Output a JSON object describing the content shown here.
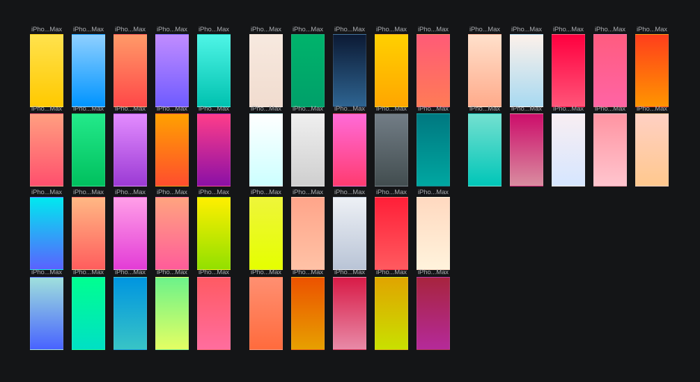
{
  "canvas": {
    "background": "#141517"
  },
  "frame_label": "iPho...Max",
  "groups": [
    {
      "rows": [
        [
          {
            "gradient": [
              "#ffe24d",
              "#ffc900"
            ]
          },
          {
            "gradient": [
              "#8fd0ff",
              "#0094ff"
            ]
          },
          {
            "gradient": [
              "#ff9a68",
              "#ff4848"
            ]
          },
          {
            "gradient": [
              "#c18cff",
              "#6f5bff"
            ]
          },
          {
            "gradient": [
              "#4ff5e6",
              "#00c2b0"
            ]
          }
        ],
        [
          {
            "gradient": [
              "#ff9f80",
              "#ff4f6d"
            ]
          },
          {
            "gradient": [
              "#23e98a",
              "#00c05e"
            ]
          },
          {
            "gradient": [
              "#e38cff",
              "#9b3ad4"
            ]
          },
          {
            "gradient": [
              "#ffa100",
              "#ff4d2e"
            ]
          },
          {
            "gradient": [
              "#ff3d8a",
              "#8a10a6"
            ]
          }
        ],
        [
          {
            "gradient": [
              "#00e9ef",
              "#5a62ff"
            ]
          },
          {
            "gradient": [
              "#ffb884",
              "#ff5d5d"
            ]
          },
          {
            "gradient": [
              "#ff9fe8",
              "#e33cd6"
            ]
          },
          {
            "gradient": [
              "#ffa47f",
              "#ff5c9a"
            ]
          },
          {
            "gradient": [
              "#ffef00",
              "#92e000"
            ]
          }
        ],
        [
          {
            "gradient": [
              "#9fe0dc",
              "#4863ff"
            ]
          },
          {
            "gradient": [
              "#00ff90",
              "#00e0c5"
            ]
          },
          {
            "gradient": [
              "#0095e0",
              "#38c4c6"
            ]
          },
          {
            "gradient": [
              "#6cf28a",
              "#e4ff63"
            ]
          },
          {
            "gradient": [
              "#ff5a63",
              "#ff6d9e"
            ]
          }
        ]
      ]
    },
    {
      "rows": [
        [
          {
            "gradient": [
              "#f7e9df",
              "#f1dccf"
            ]
          },
          {
            "gradient": [
              "#00b36b",
              "#00a06a"
            ]
          },
          {
            "gradient": [
              "#0c1a34",
              "#2e6491"
            ]
          },
          {
            "gradient": [
              "#ffd000",
              "#ffa600"
            ]
          },
          {
            "gradient": [
              "#ff5b77",
              "#ff7b56"
            ]
          }
        ],
        [
          {
            "gradient": [
              "#ffffff",
              "#ccffff"
            ]
          },
          {
            "gradient": [
              "#efefef",
              "#cfcfcf"
            ]
          },
          {
            "gradient": [
              "#ff6bd8",
              "#ff3b70"
            ]
          },
          {
            "gradient": [
              "#727d86",
              "#424d4f"
            ]
          },
          {
            "gradient": [
              "#007880",
              "#00a7a1"
            ]
          }
        ],
        [
          {
            "gradient": [
              "#eef53a",
              "#e5ff00"
            ]
          },
          {
            "gradient": [
              "#ffa58a",
              "#ffc2a6"
            ]
          },
          {
            "gradient": [
              "#edf0f5",
              "#b9c4d6"
            ]
          },
          {
            "gradient": [
              "#ff1f38",
              "#ff5a5f"
            ]
          },
          {
            "gradient": [
              "#ffd9c0",
              "#fff3dc"
            ]
          }
        ],
        [
          {
            "gradient": [
              "#ff8f71",
              "#ff6b3d"
            ]
          },
          {
            "gradient": [
              "#ec5200",
              "#e7a000"
            ]
          },
          {
            "gradient": [
              "#d81b47",
              "#e88aa7"
            ]
          },
          {
            "gradient": [
              "#e0a400",
              "#c9e000"
            ]
          },
          {
            "gradient": [
              "#a7243e",
              "#b52a9a"
            ]
          }
        ]
      ]
    },
    {
      "rows": [
        [
          {
            "gradient": [
              "#ffe0cb",
              "#ffab8b"
            ]
          },
          {
            "gradient": [
              "#fdf1ea",
              "#a7d9f1"
            ]
          },
          {
            "gradient": [
              "#ff003f",
              "#ff5478"
            ]
          },
          {
            "gradient": [
              "#ff5c80",
              "#ff64a4"
            ]
          },
          {
            "gradient": [
              "#ff3e1c",
              "#ff9500"
            ]
          }
        ],
        [
          {
            "gradient": [
              "#74e0d0",
              "#00c6b8"
            ]
          },
          {
            "gradient": [
              "#cc0d6a",
              "#d98da0"
            ]
          },
          {
            "gradient": [
              "#f8eef2",
              "#d6e6ff"
            ]
          },
          {
            "gradient": [
              "#ff94a2",
              "#ffc5ce"
            ]
          },
          {
            "gradient": [
              "#ffd0c3",
              "#ffc88e"
            ]
          }
        ]
      ]
    }
  ]
}
